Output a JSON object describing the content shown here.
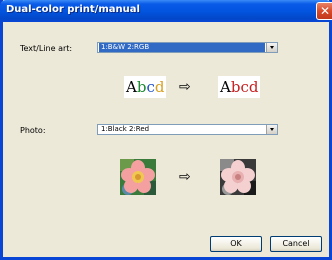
{
  "window": {
    "title": "Dual-color print/manual",
    "close_glyph": "✕"
  },
  "text_line_art": {
    "label": "Text/Line art:",
    "selected_value": "1:B&W 2:RGB",
    "before_sample": "Abcd",
    "after_sample": "Abcd",
    "arrow_glyph": "⇨",
    "colors": {
      "b": "#1a8a2e",
      "c": "#2050c8",
      "d": "#d8a020",
      "after": "#c82020",
      "after_a": "#000000"
    }
  },
  "photo": {
    "label": "Photo:",
    "selected_value": "1:Black 2:Red",
    "arrow_glyph": "⇨",
    "before_image": "flower-color-photo",
    "after_image": "flower-duotone-photo"
  },
  "buttons": {
    "ok": "OK",
    "cancel": "Cancel"
  },
  "colors": {
    "titlebar": "#0a46d6",
    "dialog_bg": "#ece9d8",
    "selection": "#316ac5",
    "close": "#d84a2a"
  }
}
